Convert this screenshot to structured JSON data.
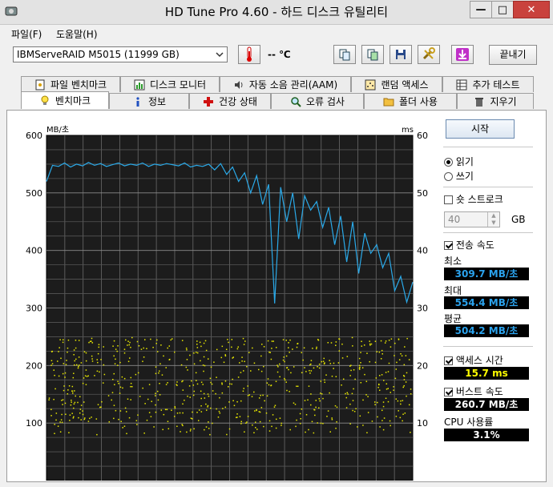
{
  "window": {
    "title": "HD Tune Pro 4.60 - 하드 디스크 유틸리티",
    "minimize": "—",
    "maximize": "□",
    "close": "✕"
  },
  "menu": {
    "file": "파일(F)",
    "help": "도움말(H)"
  },
  "toolbar": {
    "drive": "IBMServeRAID M5015 (11999 GB)",
    "temperature": "-- ℃",
    "exit_label": "끝내기"
  },
  "tabs_top": [
    "파일 벤치마크",
    "디스크 모니터",
    "자동 소음 관리(AAM)",
    "랜덤 액세스",
    "추가 테스트"
  ],
  "tabs_bottom": [
    "벤치마크",
    "정보",
    "건강 상태",
    "오류 검사",
    "폴더 사용",
    "지우기"
  ],
  "panel": {
    "start_label": "시작",
    "read_label": "읽기",
    "write_label": "쓰기",
    "short_stroke_label": "숏 스트로크",
    "short_stroke_value": "40",
    "short_stroke_unit": "GB",
    "transfer_label": "전송 속도",
    "min_label": "최소",
    "min_value": "309.7 MB/초",
    "max_label": "최대",
    "max_value": "554.4 MB/초",
    "avg_label": "평균",
    "avg_value": "504.2 MB/초",
    "access_label": "액세스 시간",
    "access_value": "15.7 ms",
    "burst_label": "버스트 속도",
    "burst_value": "260.7 MB/초",
    "cpu_label": "CPU 사용률",
    "cpu_value": "3.1%"
  },
  "colors": {
    "transfer_line": "#2aa9e8",
    "access_dots": "#e8e800",
    "chart_bg": "#1c1c1c",
    "value_blue": "#2ba3ee",
    "value_yellow": "#ffff00",
    "value_white": "#ffffff"
  },
  "chart_data": {
    "type": "line",
    "left_unit": "MB/초",
    "right_unit": "ms",
    "left_ticks": [
      "600",
      "500",
      "400",
      "300",
      "200",
      "100"
    ],
    "right_ticks": [
      "60",
      "50",
      "40",
      "30",
      "20",
      "10"
    ],
    "ylim_left": [
      0,
      600
    ],
    "ylim_right": [
      0,
      60
    ],
    "grid": true,
    "transfer_series": {
      "x": [
        0,
        2,
        4,
        6,
        8,
        10,
        12,
        14,
        16,
        18,
        20,
        22,
        24,
        26,
        28,
        30,
        32,
        34,
        36,
        38,
        40,
        42,
        44,
        46,
        48,
        50,
        52,
        54,
        56,
        58,
        60,
        62,
        64,
        66,
        68,
        70,
        72,
        74,
        76,
        78,
        80,
        82,
        84,
        86,
        88,
        90,
        92,
        94,
        96,
        98,
        100
      ],
      "y": [
        520,
        548,
        546,
        552,
        545,
        550,
        547,
        553,
        548,
        551,
        546,
        549,
        552,
        547,
        550,
        548,
        552,
        546,
        550,
        548,
        551,
        549,
        547,
        552,
        545,
        548,
        546,
        550,
        540,
        551,
        532,
        545,
        520,
        535,
        500,
        530,
        480,
        515,
        308,
        510,
        450,
        500,
        420,
        495,
        470,
        485,
        440,
        475,
        410,
        460,
        380,
        450,
        360,
        430,
        395,
        410,
        370,
        395,
        330,
        355,
        310,
        345
      ]
    },
    "access_scatter_range_ms": [
      8,
      25
    ]
  }
}
